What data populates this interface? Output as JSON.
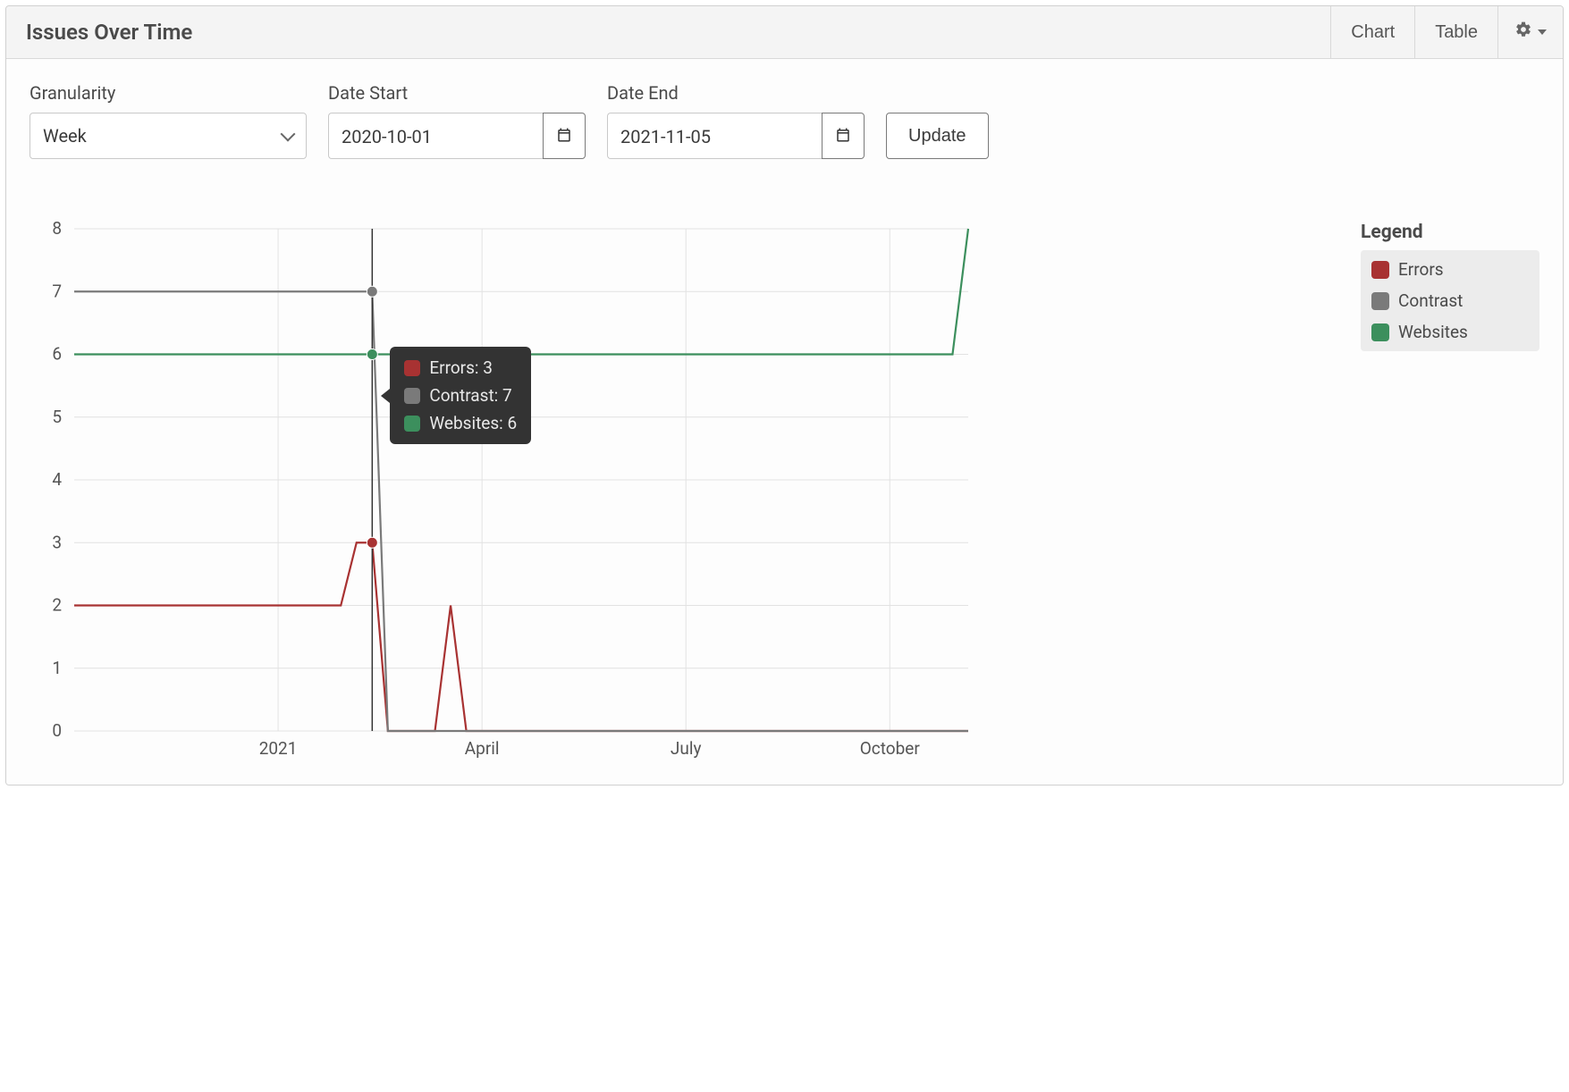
{
  "header": {
    "title": "Issues Over Time",
    "tab_chart": "Chart",
    "tab_table": "Table"
  },
  "controls": {
    "granularity_label": "Granularity",
    "granularity_value": "Week",
    "date_start_label": "Date Start",
    "date_start_value": "2020-10-01",
    "date_end_label": "Date End",
    "date_end_value": "2021-11-05",
    "update_label": "Update"
  },
  "legend": {
    "title": "Legend",
    "items": [
      {
        "label": "Errors",
        "color": "#a83232"
      },
      {
        "label": "Contrast",
        "color": "#7a7a7a"
      },
      {
        "label": "Websites",
        "color": "#3c8f5d"
      }
    ]
  },
  "tooltip": {
    "rows": [
      {
        "label": "Errors: 3",
        "color": "#a83232"
      },
      {
        "label": "Contrast: 7",
        "color": "#7a7a7a"
      },
      {
        "label": "Websites: 6",
        "color": "#3c8f5d"
      }
    ]
  },
  "chart_data": {
    "type": "line",
    "xlabel": "",
    "ylabel": "",
    "ylim": [
      0,
      8
    ],
    "y_ticks": [
      0,
      1,
      2,
      3,
      4,
      5,
      6,
      7,
      8
    ],
    "x_tick_labels": [
      "2021",
      "April",
      "July",
      "October"
    ],
    "x_domain_weeks": [
      "2020-10-01",
      "2021-11-05"
    ],
    "hover_week_index": 19,
    "series": [
      {
        "name": "Errors",
        "color": "#a83232",
        "values": [
          2,
          2,
          2,
          2,
          2,
          2,
          2,
          2,
          2,
          2,
          2,
          2,
          2,
          2,
          2,
          2,
          2,
          2,
          3,
          3,
          0,
          0,
          0,
          0,
          2,
          0,
          0,
          0,
          0,
          0,
          0,
          0,
          0,
          0,
          0,
          0,
          0,
          0,
          0,
          0,
          0,
          0,
          0,
          0,
          0,
          0,
          0,
          0,
          0,
          0,
          0,
          0,
          0,
          0,
          0,
          0,
          0,
          0
        ]
      },
      {
        "name": "Contrast",
        "color": "#7a7a7a",
        "values": [
          7,
          7,
          7,
          7,
          7,
          7,
          7,
          7,
          7,
          7,
          7,
          7,
          7,
          7,
          7,
          7,
          7,
          7,
          7,
          7,
          0,
          0,
          0,
          0,
          0,
          0,
          0,
          0,
          0,
          0,
          0,
          0,
          0,
          0,
          0,
          0,
          0,
          0,
          0,
          0,
          0,
          0,
          0,
          0,
          0,
          0,
          0,
          0,
          0,
          0,
          0,
          0,
          0,
          0,
          0,
          0,
          0,
          0
        ]
      },
      {
        "name": "Websites",
        "color": "#3c8f5d",
        "values": [
          6,
          6,
          6,
          6,
          6,
          6,
          6,
          6,
          6,
          6,
          6,
          6,
          6,
          6,
          6,
          6,
          6,
          6,
          6,
          6,
          6,
          6,
          6,
          6,
          6,
          6,
          6,
          6,
          6,
          6,
          6,
          6,
          6,
          6,
          6,
          6,
          6,
          6,
          6,
          6,
          6,
          6,
          6,
          6,
          6,
          6,
          6,
          6,
          6,
          6,
          6,
          6,
          6,
          6,
          6,
          6,
          6,
          8
        ]
      }
    ],
    "x_tick_positions_index": [
      13,
      26,
      39,
      52
    ]
  }
}
